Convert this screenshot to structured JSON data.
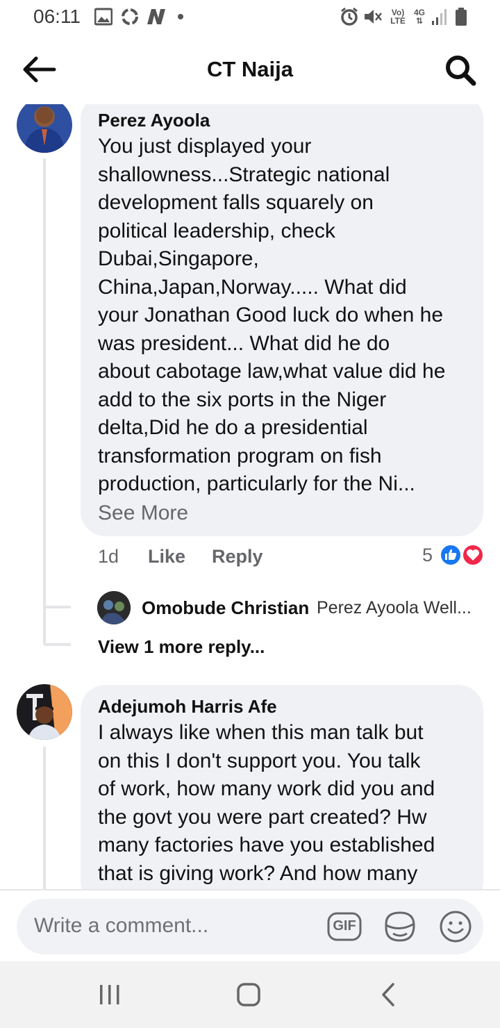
{
  "status_bar": {
    "time": "06:11",
    "network_label_top": "Vo)",
    "network_label_bottom": "LTE",
    "signal_label": "4G"
  },
  "header": {
    "title": "CT Naija"
  },
  "comments": [
    {
      "author": "Perez Ayoola",
      "text_lines": [
        "You just displayed your",
        "shallowness...Strategic national",
        "development falls squarely on",
        "political leadership, check",
        "Dubai,Singapore,",
        "China,Japan,Norway..... What did",
        "your Jonathan Good luck do when he",
        "was president... What did he do",
        "about cabotage law,what value did he",
        "add to the six ports in the Niger",
        "delta,Did he do a presidential",
        "transformation program on fish",
        "production, particularly for the Ni..."
      ],
      "see_more": "See More",
      "time": "1d",
      "like": "Like",
      "reply": "Reply",
      "reaction_count": "5",
      "reply_preview": {
        "author": "Omobude Christian",
        "snippet": "Perez Ayoola Well..."
      },
      "view_more_replies": "View 1 more reply..."
    },
    {
      "author": "Adejumoh Harris Afe",
      "text_lines": [
        "I always like when this man talk but",
        "on this I don't support you. You talk",
        "of work, how many work did you and",
        "the govt you were part created? Hw",
        "many factories have you established",
        "that is giving work? And how many"
      ]
    }
  ],
  "composer": {
    "placeholder": "Write a comment...",
    "gif_label": "GIF"
  },
  "colors": {
    "bubble": "#eff1f5",
    "like_blue": "#1877f2",
    "love_red": "#f0284a",
    "secondary_text": "#65676b"
  }
}
